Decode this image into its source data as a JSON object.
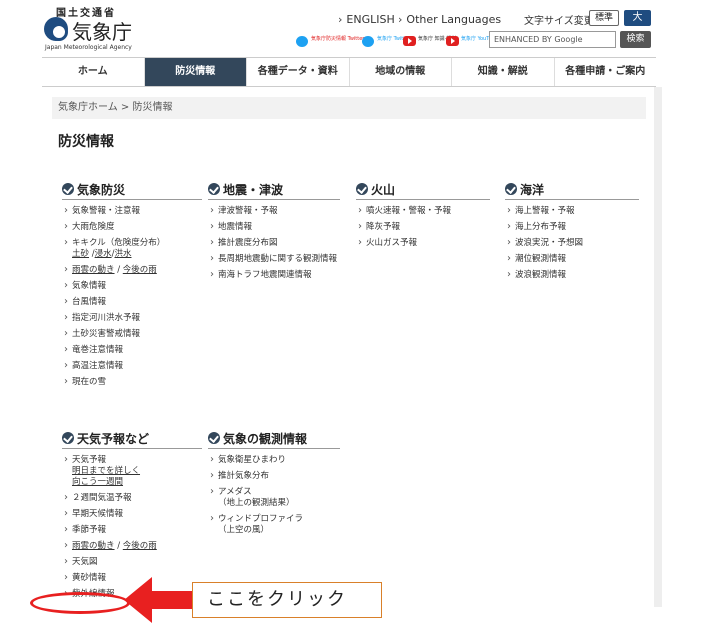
{
  "header": {
    "ministry": "国土交通省",
    "agency": "気象庁",
    "agency_en": "Japan Meteorological Agency",
    "lang_english": "ENGLISH",
    "lang_other": "Other Languages",
    "fontsize_label": "文字サイズ変更",
    "fontsize_standard": "標準",
    "fontsize_large": "大",
    "social": [
      {
        "label": "気象庁防災情報 Twitter",
        "icon": "twitter-icon"
      },
      {
        "label": "気象庁 Twitter",
        "icon": "twitter-icon"
      },
      {
        "label": "気象庁 知識·解説",
        "icon": "youtube-icon"
      },
      {
        "label": "気象庁 YouTube",
        "icon": "youtube-icon"
      }
    ],
    "search_placeholder": "ENHANCED BY Google",
    "search_button": "検索"
  },
  "nav": {
    "items": [
      "ホーム",
      "防災情報",
      "各種データ・資料",
      "地域の情報",
      "知識・解説",
      "各種申請・ご案内"
    ],
    "active_index": 1
  },
  "breadcrumb": {
    "home": "気象庁ホーム",
    "sep": " > ",
    "current": "防災情報"
  },
  "page_title": "防災情報",
  "sections": {
    "bosai": {
      "title": "気象防災",
      "items": [
        "気象警報・注意報",
        "大雨危険度",
        "キキクル（危険度分布）",
        "雨雲の動き",
        "今後の雨",
        "気象情報",
        "台風情報",
        "指定河川洪水予報",
        "土砂災害警戒情報",
        "竜巻注意情報",
        "高温注意情報",
        "現在の雪"
      ],
      "kikikuru_sub": [
        "土砂",
        "浸水",
        "洪水"
      ]
    },
    "jishin": {
      "title": "地震・津波",
      "items": [
        "津波警報・予報",
        "地震情報",
        "推計震度分布図",
        "長周期地震動に関する観測情報",
        "南海トラフ地震関連情報"
      ]
    },
    "kazan": {
      "title": "火山",
      "items": [
        "噴火速報・警報・予報",
        "降灰予報",
        "火山ガス予報"
      ]
    },
    "kaiyo": {
      "title": "海洋",
      "items": [
        "海上警報・予報",
        "海上分布予報",
        "波浪実況・予想図",
        "潮位観測情報",
        "波浪観測情報"
      ]
    },
    "tenki": {
      "title": "天気予報など",
      "items": [
        "天気予報",
        "明日までを詳しく",
        "向こう一週間",
        "２週間気温予報",
        "早期天候情報",
        "季節予報",
        "雨雲の動き",
        "今後の雨",
        "天気図",
        "黄砂情報",
        "紫外線情報"
      ]
    },
    "kansoku": {
      "title": "気象の観測情報",
      "items": [
        "気象衛星ひまわり",
        "推計気象分布",
        "アメダス",
        "（地上の観測結果）",
        "ウィンドプロファイラ",
        "（上空の風）"
      ]
    }
  },
  "slash": "/",
  "annotation": {
    "text": "ここをクリック",
    "color": "#e82020"
  }
}
